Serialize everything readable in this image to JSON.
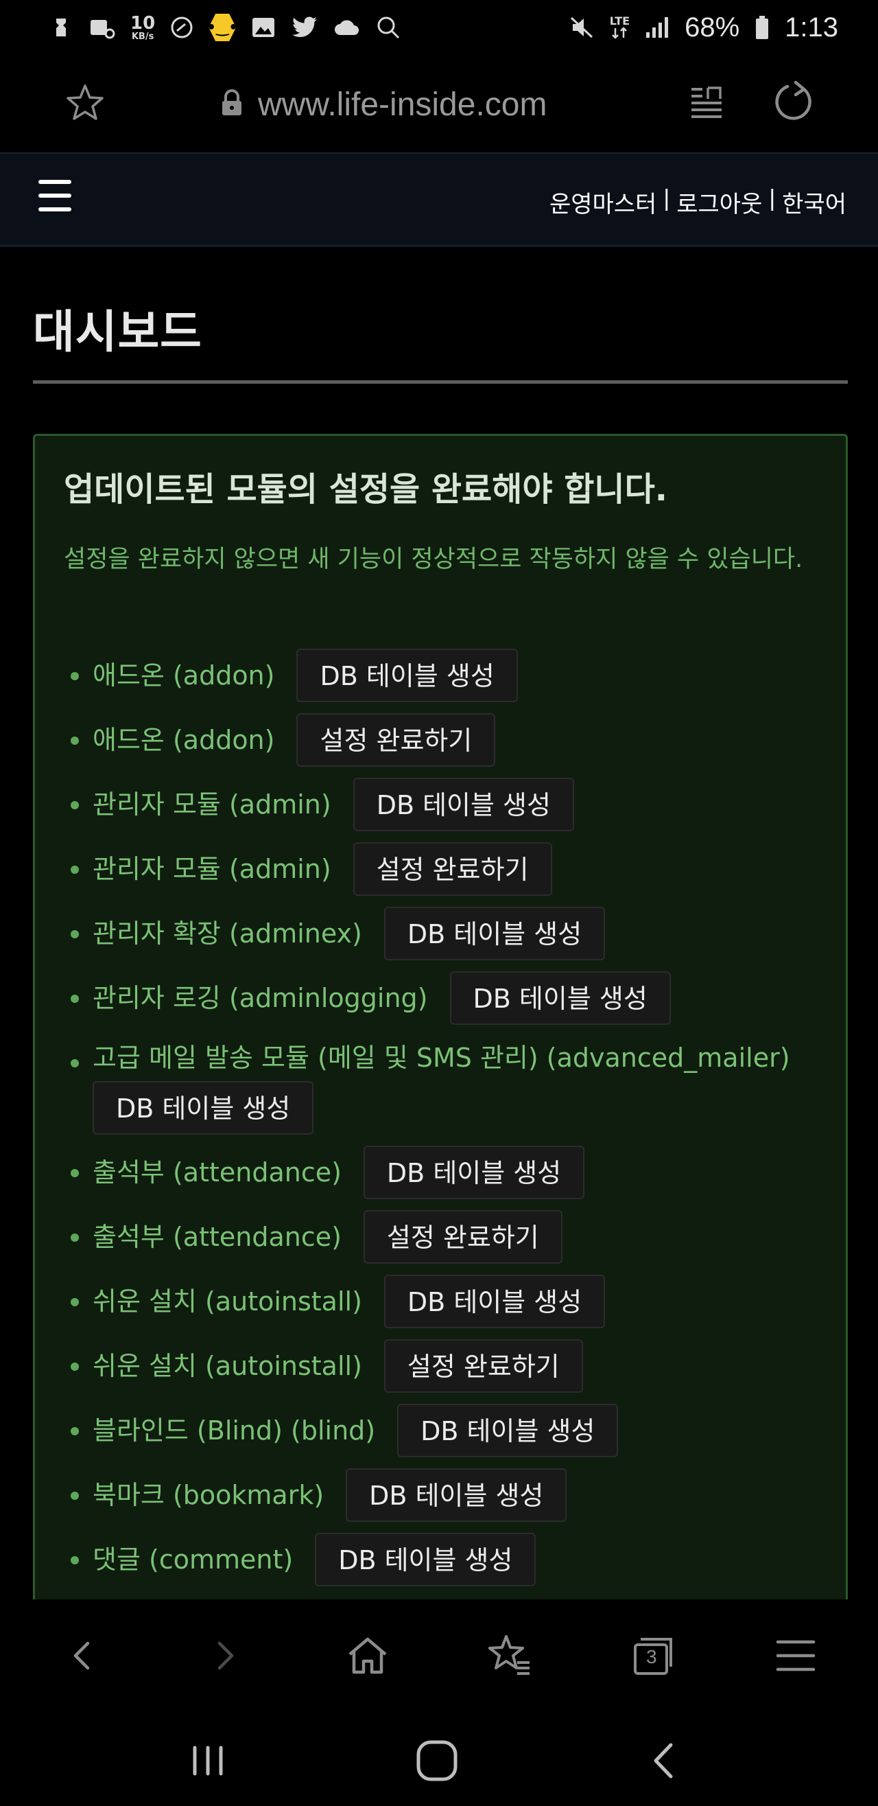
{
  "status_bar": {
    "net_speed_value": "10",
    "net_speed_unit": "KB/s",
    "network_label": "LTE",
    "battery": "68%",
    "time": "1:13",
    "left_icons": [
      "app-icon",
      "screen-recorder-icon",
      "speed-icon",
      "sticker-app-icon",
      "gallery-icon",
      "twitter-icon",
      "cloud-icon",
      "search-icon"
    ],
    "right_icons": [
      "mute-icon",
      "lte-icon",
      "signal-icon",
      "battery-icon"
    ]
  },
  "browser": {
    "url": "www.life-inside.com",
    "icons": [
      "bookmark-star-icon",
      "lock-icon",
      "reader-mode-icon",
      "reload-icon"
    ]
  },
  "site_header": {
    "user_links": [
      "운영마스터",
      "로그아웃",
      "한국어"
    ],
    "separator": "|"
  },
  "page": {
    "title": "대시보드"
  },
  "alert": {
    "title": "업데이트된 모듈의 설정을 완료해야 합니다.",
    "description": "설정을 완료하지 않으면 새 기능이 정상적으로 작동하지 않을 수 있습니다.",
    "accent_color": "#7bc276",
    "items": [
      {
        "name": "애드온 (addon)",
        "action": "DB 테이블 생성"
      },
      {
        "name": "애드온 (addon)",
        "action": "설정 완료하기"
      },
      {
        "name": "관리자 모듈 (admin)",
        "action": "DB 테이블 생성"
      },
      {
        "name": "관리자 모듈 (admin)",
        "action": "설정 완료하기"
      },
      {
        "name": "관리자 확장 (adminex)",
        "action": "DB 테이블 생성"
      },
      {
        "name": "관리자 로깅 (adminlogging)",
        "action": "DB 테이블 생성"
      },
      {
        "name": "고급 메일 발송 모듈 (메일 및 SMS 관리) (advanced_mailer)",
        "action": "DB 테이블 생성"
      },
      {
        "name": "출석부 (attendance)",
        "action": "DB 테이블 생성"
      },
      {
        "name": "출석부 (attendance)",
        "action": "설정 완료하기"
      },
      {
        "name": "쉬운 설치 (autoinstall)",
        "action": "DB 테이블 생성"
      },
      {
        "name": "쉬운 설치 (autoinstall)",
        "action": "설정 완료하기"
      },
      {
        "name": "블라인드 (Blind) (blind)",
        "action": "DB 테이블 생성"
      },
      {
        "name": "북마크 (bookmark)",
        "action": "DB 테이블 생성"
      },
      {
        "name": "댓글 (comment)",
        "action": "DB 테이블 생성"
      }
    ]
  },
  "bottom_nav": {
    "tab_count": "3",
    "icons": [
      "back-icon",
      "forward-icon",
      "home-icon",
      "bookmarks-icon",
      "tabs-icon",
      "menu-icon"
    ]
  },
  "system_nav": {
    "icons": [
      "recent-apps-icon",
      "home-button-icon",
      "system-back-icon"
    ]
  }
}
